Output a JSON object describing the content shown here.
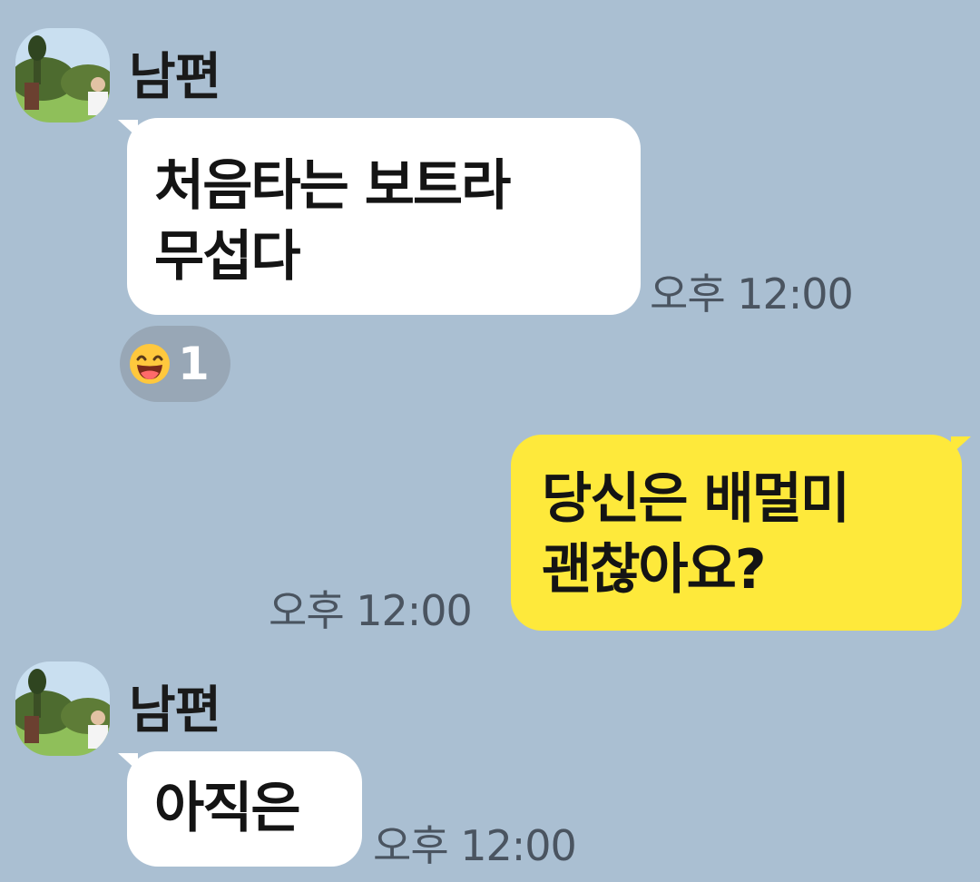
{
  "chat": {
    "background_color": "#aabfd2",
    "bubble_colors": {
      "received": "#ffffff",
      "sent": "#fee93b"
    },
    "messages": [
      {
        "direction": "received",
        "sender": "남편",
        "lines": [
          "처음타는 보트라",
          "무섭다"
        ],
        "time": "오후 12:00",
        "reaction": {
          "icon": "laughing-face-emoji",
          "count": "1"
        }
      },
      {
        "direction": "sent",
        "lines": [
          "당신은 배멀미",
          "괜찮아요?"
        ],
        "time": "오후 12:00"
      },
      {
        "direction": "received",
        "sender": "남편",
        "lines": [
          "아직은"
        ],
        "time": "오후 12:00"
      }
    ]
  }
}
